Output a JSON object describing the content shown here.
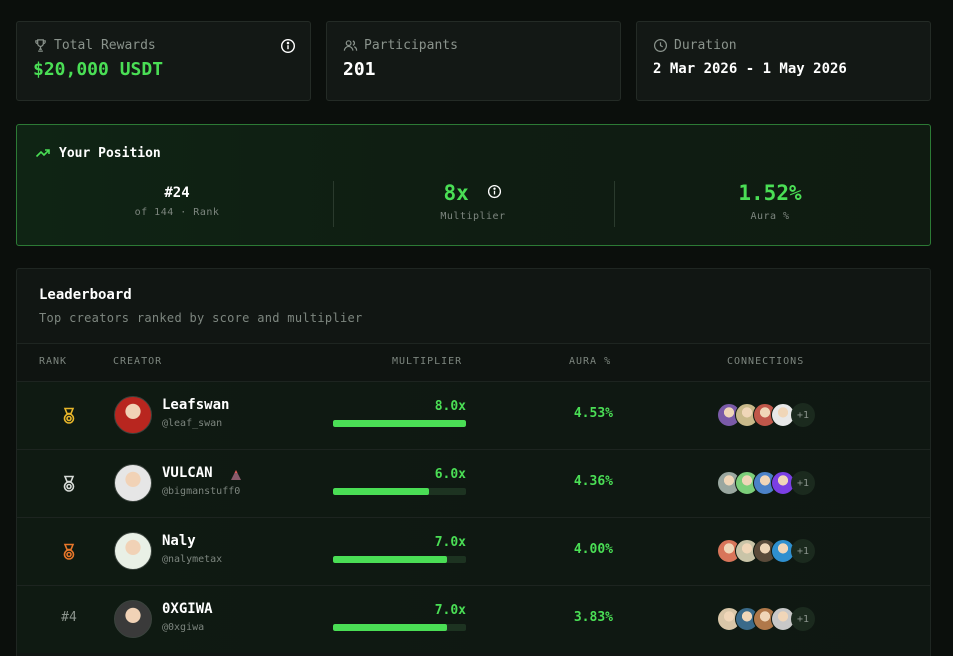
{
  "stats": {
    "rewards": {
      "label": "Total Rewards",
      "value": "$20,000 USDT"
    },
    "participants": {
      "label": "Participants",
      "value": "201"
    },
    "duration": {
      "label": "Duration",
      "value": "2 Mar 2026 - 1 May 2026"
    }
  },
  "position": {
    "title": "Your Position",
    "rank": {
      "value": "#24",
      "sub": "of 144 · Rank"
    },
    "multiplier": {
      "value": "8x",
      "sub": "Multiplier"
    },
    "aura": {
      "value": "1.52%",
      "sub": "Aura %"
    }
  },
  "leaderboard": {
    "title": "Leaderboard",
    "subtitle": "Top creators ranked by score and multiplier",
    "columns": {
      "rank": "RANK",
      "creator": "CREATOR",
      "multiplier": "MULTIPLIER",
      "aura": "AURA %",
      "connections": "CONNECTIONS"
    },
    "rows": [
      {
        "rank": "",
        "medal": "gold",
        "name": "Leafswan",
        "handle": "@leaf_swan",
        "multiplier": "8.0x",
        "multiplier_fraction": 1.0,
        "aura": "4.53%",
        "connections_more": "+1",
        "avatar_color": "#b8261f",
        "conn_colors": [
          "#7a5aa8",
          "#c9b98a",
          "#c0574a",
          "#e8e8e8"
        ]
      },
      {
        "rank": "",
        "medal": "silver",
        "name": "VULCAN",
        "handle": "@bigmanstuff0",
        "multiplier": "6.0x",
        "multiplier_fraction": 0.72,
        "aura": "4.36%",
        "connections_more": "+1",
        "avatar_color": "#e6e6e6",
        "conn_colors": [
          "#9aa7a0",
          "#7ccf7a",
          "#4c82c8",
          "#7b3fe4"
        ]
      },
      {
        "rank": "",
        "medal": "bronze",
        "name": "Naly",
        "handle": "@nalymetax",
        "multiplier": "7.0x",
        "multiplier_fraction": 0.86,
        "aura": "4.00%",
        "connections_more": "+1",
        "avatar_color": "#e9f0e6",
        "conn_colors": [
          "#d8755a",
          "#c9c4a8",
          "#5a4a3a",
          "#2f8fcf"
        ]
      },
      {
        "rank": "#4",
        "medal": "",
        "name": "0XGIWA",
        "handle": "@0xgiwa",
        "multiplier": "7.0x",
        "multiplier_fraction": 0.86,
        "aura": "3.83%",
        "connections_more": "+1",
        "avatar_color": "#3a3a3a",
        "conn_colors": [
          "#d9c6a8",
          "#3a6a8a",
          "#b0784a",
          "#c8c8c8"
        ]
      }
    ]
  },
  "colors": {
    "accent": "#4ade55",
    "gold": "#e8b62a",
    "silver": "#d8dcd8",
    "bronze": "#e8772a"
  }
}
